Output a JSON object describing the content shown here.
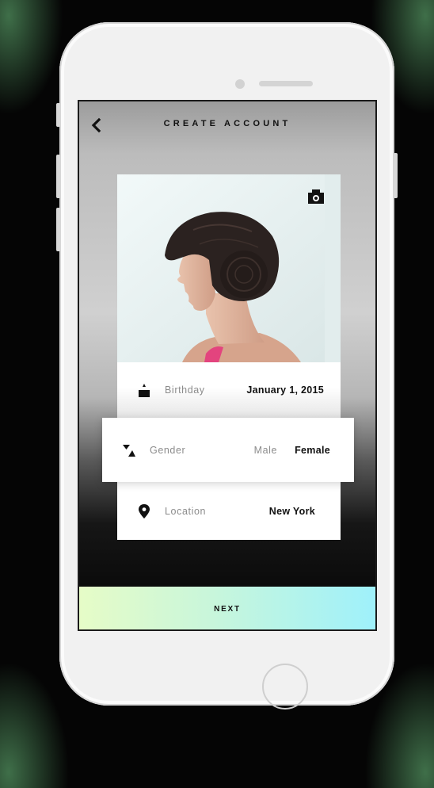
{
  "header": {
    "title": "CREATE ACCOUNT",
    "back_icon": "chevron-left-icon"
  },
  "photo": {
    "camera_icon": "camera-icon"
  },
  "form": {
    "birthday": {
      "icon": "cake-icon",
      "label": "Birthday",
      "value": "January 1, 2015"
    },
    "gender": {
      "icon": "gender-icon",
      "label": "Gender",
      "options": [
        "Male",
        "Female"
      ],
      "selected": "Female"
    },
    "location": {
      "icon": "location-pin-icon",
      "label": "Location",
      "value": "New York"
    }
  },
  "footer": {
    "next_label": "NEXT"
  },
  "colors": {
    "next_gradient_start": "#e6fcc7",
    "next_gradient_end": "#9ff1fb",
    "text_dark": "#111111",
    "text_muted": "#8c8c8c"
  }
}
